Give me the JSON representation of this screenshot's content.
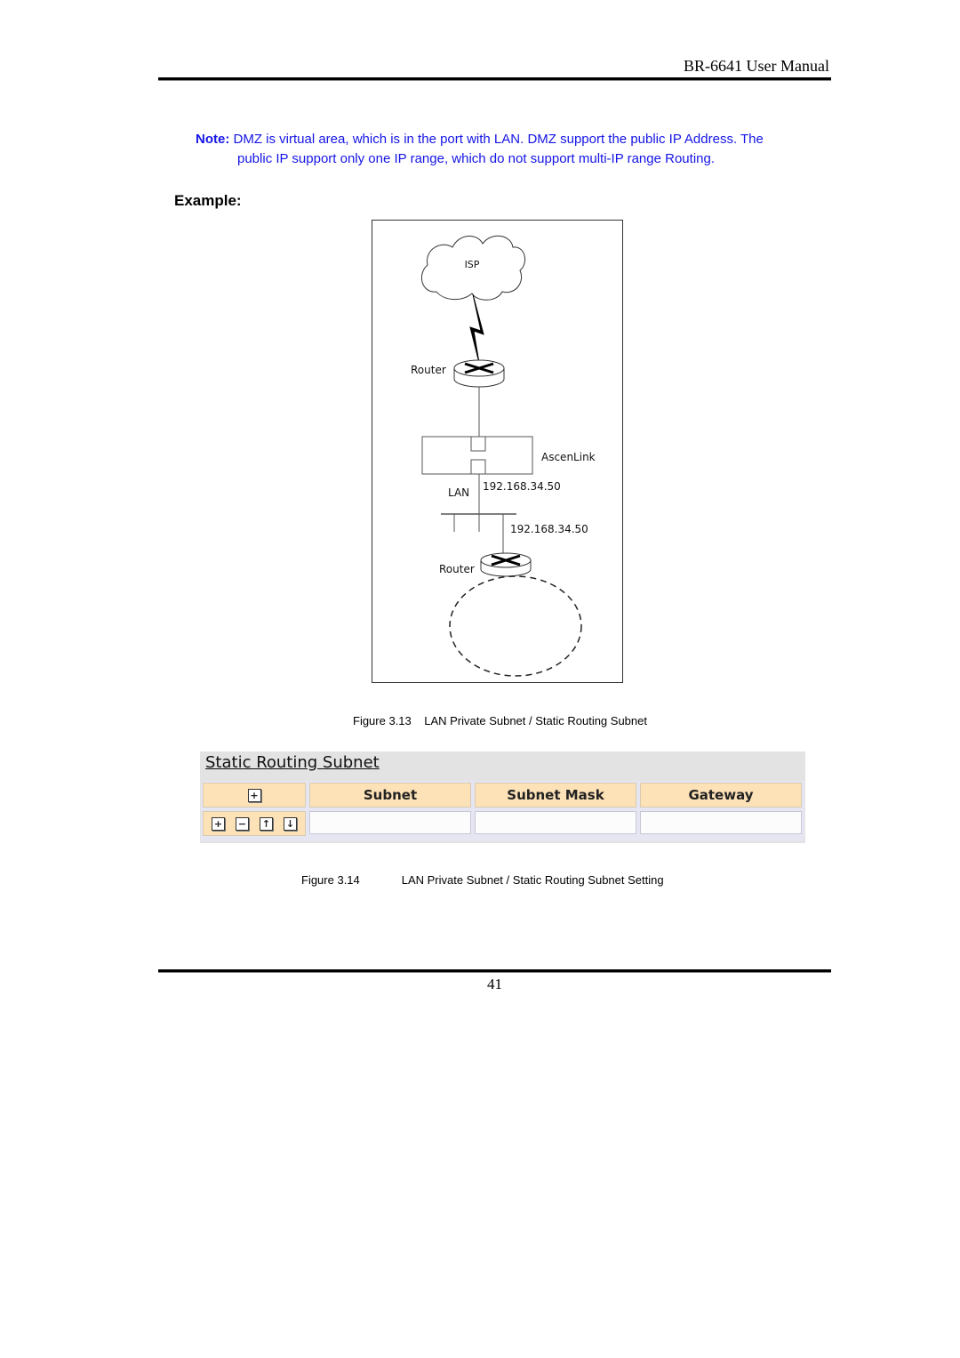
{
  "header": {
    "title": "BR-6641 User Manual"
  },
  "note": {
    "label": "Note:",
    "line1": "DMZ is virtual area, which is in the port with LAN. DMZ support the public IP Address. The",
    "line2": "public IP support only one IP range, which do not support multi-IP range Routing."
  },
  "example_heading": "Example:",
  "diagram": {
    "isp_label": "ISP",
    "router1_label": "Router",
    "device_label": "AscenLink",
    "lan_label": "LAN",
    "ip1": "192.168.34.50",
    "ip2": "192.168.34.50",
    "router2_label": "Router"
  },
  "figure13": {
    "number": "Figure 3.13",
    "title": "LAN Private Subnet / Static Routing Subnet"
  },
  "panel": {
    "title": "Static Routing Subnet",
    "columns": [
      "Subnet",
      "Subnet Mask",
      "Gateway"
    ],
    "header_add_icon": "+",
    "row_buttons": [
      {
        "name": "add",
        "glyph": "+"
      },
      {
        "name": "remove",
        "glyph": "−"
      },
      {
        "name": "move-up",
        "glyph": "↑"
      },
      {
        "name": "move-down",
        "glyph": "↓"
      }
    ],
    "rows": [
      {
        "subnet": "",
        "mask": "",
        "gateway": ""
      }
    ]
  },
  "figure14": {
    "number": "Figure 3.14",
    "title": "LAN Private Subnet / Static Routing Subnet Setting"
  },
  "page_number": "41"
}
